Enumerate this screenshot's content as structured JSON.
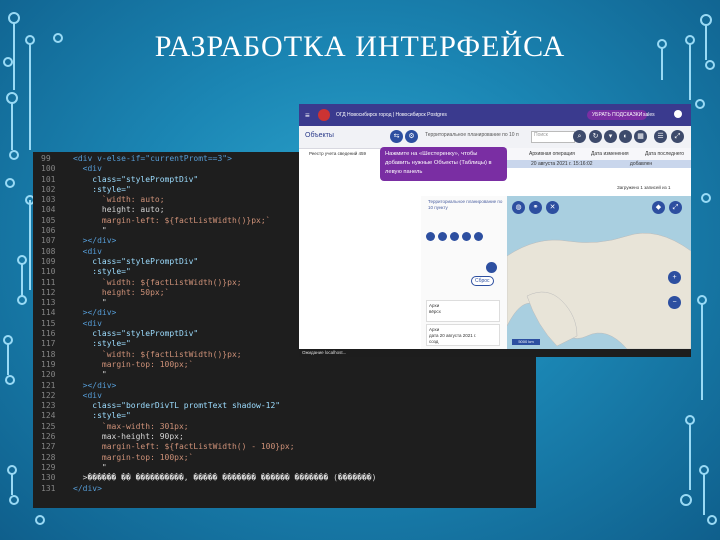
{
  "slide": {
    "title": "РАЗРАБОТКА ИНТЕРФЕЙСА"
  },
  "code": {
    "line_numbers": [
      "99",
      "100",
      "101",
      "102",
      "103",
      "104",
      "105",
      "106",
      "107",
      "108",
      "109",
      "110",
      "111",
      "112",
      "113",
      "114",
      "115",
      "116",
      "117",
      "118",
      "119",
      "120",
      "121",
      "122",
      "123",
      "124",
      "125",
      "126",
      "127",
      "128",
      "129",
      "130",
      "131"
    ],
    "lines": [
      "<div v-else-if=\"currentPromt==3\">",
      "  <div",
      "    class=\"stylePromptDiv\"",
      "    :style=\"",
      "      `width: auto;",
      "      height: auto;",
      "      margin-left: ${factListWidth()}px;`",
      "      \"",
      "  ></div>",
      "  <div",
      "    class=\"stylePromptDiv\"",
      "    :style=\"",
      "      `width: ${factListWidth()}px;",
      "      height: 50px;`",
      "      \"",
      "  ></div>",
      "  <div",
      "    class=\"stylePromptDiv\"",
      "    :style=\"",
      "      `width: ${factListWidth()}px;",
      "      margin-top: 100px;`",
      "      \"",
      "  ></div>",
      "  <div",
      "    class=\"borderDivTL promtText shadow-12\"",
      "    :style=\"",
      "      `max-width: 301px;",
      "      max-height: 90px;",
      "      margin-left: ${factListWidth() - 100}px;",
      "      margin-top: 100px;`",
      "      \"",
      "  >������ �� ����������, ����� ������� ������ ������� (�������)",
      "</div>"
    ]
  },
  "app": {
    "header": {
      "title": "ОГД Новосибирск город | Новосибирск Postgres",
      "hide_hints_label": "УБРАТЬ ПОДСКАЗКИ",
      "user": "sales"
    },
    "toolbar": {
      "objects_label": "Объекты",
      "territory_text": "Территориальное планирование по 10 п",
      "search_placeholder": "Поиск"
    },
    "registry_item": "Реестр учета сведений 459",
    "tooltip_text": "Нажмите на «Шестеренку», чтобы добавить нужные Объекты (Таблицы) в левую панель",
    "grid": {
      "col_operation": "Архивная операция",
      "col_change_date": "Дата изменения",
      "col_last_date": "Дата последнего",
      "row_date": "20 августа 2021 г. 15:16:02",
      "row_user": "добавлен"
    },
    "loaded_text": "Загружено 1 записей из 1",
    "side_panel": {
      "territory_label": "Территориальное планирование по 10 пункту",
      "reset_label": "Сброс",
      "cards": [
        {
          "line1": "Архи",
          "line2": "вёрсх"
        },
        {
          "line1": "Архи",
          "line2": "дата  20 августа 2021 г.",
          "line3": "созд"
        }
      ]
    },
    "map": {
      "scale_label": "5000 km"
    },
    "status_text": "Ожидание localhost..."
  }
}
